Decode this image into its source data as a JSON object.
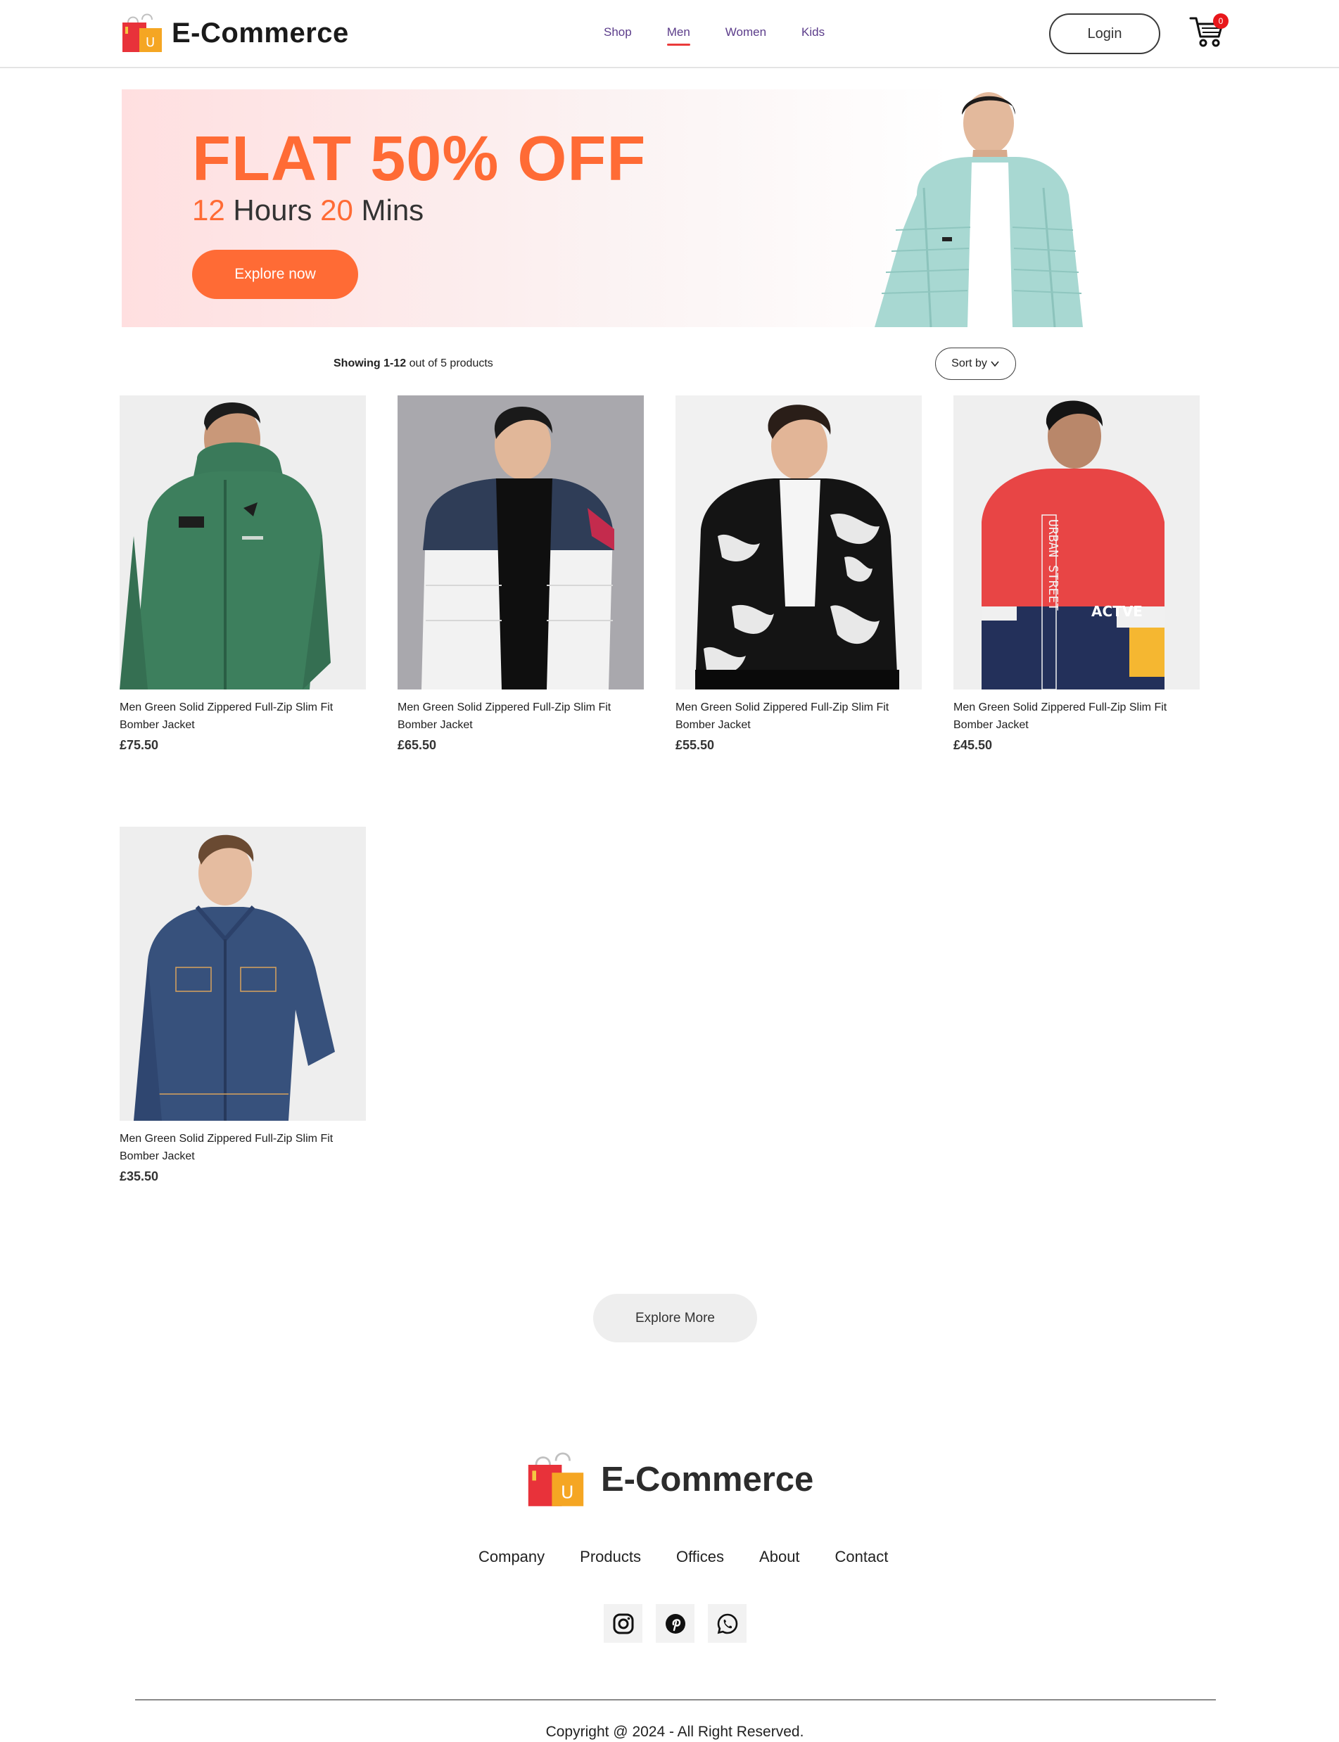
{
  "header": {
    "brand": "E-Commerce",
    "nav": [
      {
        "label": "Shop",
        "active": false
      },
      {
        "label": "Men",
        "active": true
      },
      {
        "label": "Women",
        "active": false
      },
      {
        "label": "Kids",
        "active": false
      }
    ],
    "login_label": "Login",
    "cart_count": "0",
    "cart_icon": "cart-icon"
  },
  "banner": {
    "title": "FLAT 50% OFF",
    "hours_value": "12",
    "hours_label": "Hours",
    "mins_value": "20",
    "mins_label": "Mins",
    "button_label": "Explore now"
  },
  "listing": {
    "showing_prefix": "Showing",
    "showing_range": "1-12",
    "showing_suffix": "out of 5 products",
    "sort_label": "Sort by"
  },
  "products": [
    {
      "name": "Men Green Solid Zippered Full-Zip Slim Fit Bomber Jacket",
      "price": "£75.50"
    },
    {
      "name": "Men Green Solid Zippered Full-Zip Slim Fit Bomber Jacket",
      "price": "£65.50"
    },
    {
      "name": "Men Green Solid Zippered Full-Zip Slim Fit Bomber Jacket",
      "price": "£55.50"
    },
    {
      "name": "Men Green Solid Zippered Full-Zip Slim Fit Bomber Jacket",
      "price": "£45.50"
    },
    {
      "name": "Men Green Solid Zippered Full-Zip Slim Fit Bomber Jacket",
      "price": "£35.50"
    }
  ],
  "explore_more_label": "Explore More",
  "footer": {
    "brand": "E-Commerce",
    "links": [
      "Company",
      "Products",
      "Offices",
      "About",
      "Contact"
    ],
    "socials": [
      "instagram-icon",
      "pinterest-icon",
      "whatsapp-icon"
    ],
    "copyright": "Copyright @ 2024 - All Right Reserved."
  },
  "colors": {
    "accent": "#ff6b35",
    "nav_text": "#5b3c8a",
    "nav_underline": "#ea3b3b",
    "badge": "#e8171b"
  }
}
